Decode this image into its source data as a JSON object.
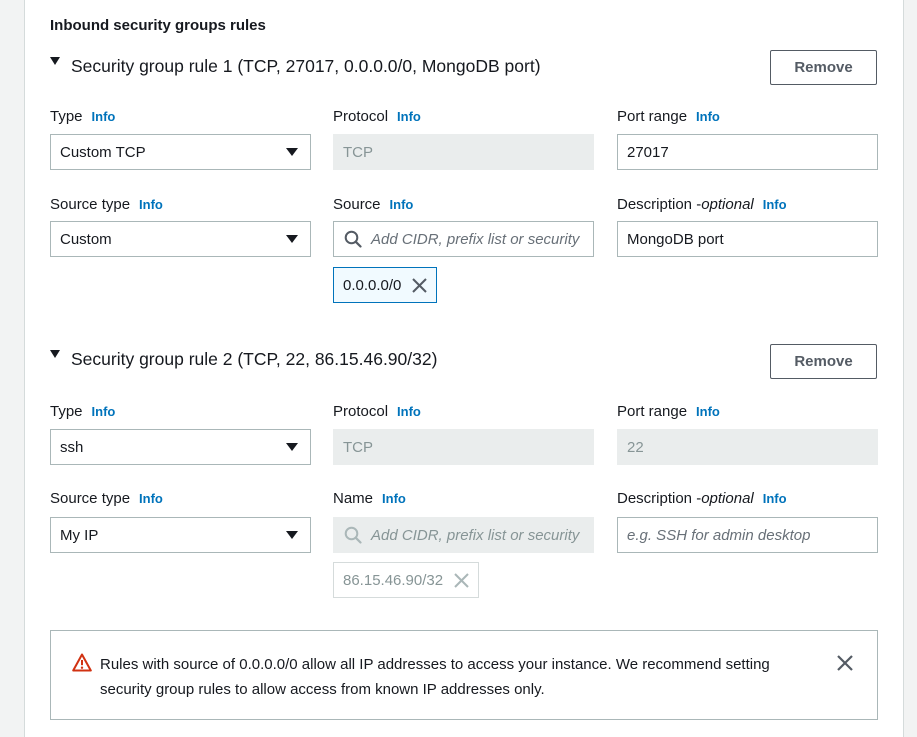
{
  "section_title": "Inbound security groups rules",
  "info_label": "Info",
  "rules": [
    {
      "title": "Security group rule 1 (TCP, 27017, 0.0.0.0/0, MongoDB port)",
      "remove_label": "Remove",
      "type_label": "Type",
      "type_value": "Custom TCP",
      "protocol_label": "Protocol",
      "protocol_value": "TCP",
      "port_range_label": "Port range",
      "port_range_value": "27017",
      "source_type_label": "Source type",
      "source_type_value": "Custom",
      "source_label": "Source",
      "source_placeholder": "Add CIDR, prefix list or security",
      "source_token": "0.0.0.0/0",
      "description_label": "Description - ",
      "description_optional": "optional",
      "description_value": "MongoDB port"
    },
    {
      "title": "Security group rule 2 (TCP, 22, 86.15.46.90/32)",
      "remove_label": "Remove",
      "type_label": "Type",
      "type_value": "ssh",
      "protocol_label": "Protocol",
      "protocol_value": "TCP",
      "port_range_label": "Port range",
      "port_range_value": "22",
      "source_type_label": "Source type",
      "source_type_value": "My IP",
      "source_label": "Name",
      "source_placeholder": "Add CIDR, prefix list or security",
      "source_token": "86.15.46.90/32",
      "description_label": "Description - ",
      "description_optional": "optional",
      "description_placeholder": "e.g. SSH for admin desktop"
    }
  ],
  "alert": {
    "text": "Rules with source of 0.0.0.0/0 allow all IP addresses to access your instance. We recommend setting security group rules to allow access from known IP addresses only.",
    "icon": "warning-icon",
    "close_icon": "close-icon"
  },
  "colors": {
    "info_link": "#0073bb",
    "warning": "#d13212",
    "token_border": "#0073bb",
    "disabled_bg": "#eaeded"
  }
}
